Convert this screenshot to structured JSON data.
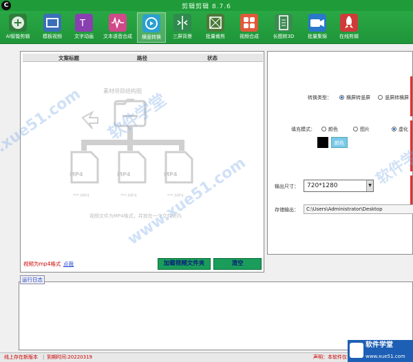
{
  "window": {
    "title": "剪辑剪辑 8.7.6",
    "logo": "C"
  },
  "toolbar": [
    {
      "id": "ai-clip",
      "label": "AI智能剪辑",
      "color": "#2f7d3b",
      "active": false
    },
    {
      "id": "template-video",
      "label": "模板视频",
      "color": "#3a6fb8",
      "active": false
    },
    {
      "id": "text-animation",
      "label": "文字动画",
      "color": "#8a3fb0",
      "active": false
    },
    {
      "id": "text-to-speech",
      "label": "文本语音合成",
      "color": "#d04a8a",
      "active": false
    },
    {
      "id": "landscape-convert",
      "label": "横竖转换",
      "color": "#2aa0d0",
      "active": true
    },
    {
      "id": "three-screen",
      "label": "三屏背景",
      "color": "#2f8a4e",
      "active": false
    },
    {
      "id": "batch-cut",
      "label": "批量裁剪",
      "color": "#4a7a38",
      "active": false
    },
    {
      "id": "video-merge",
      "label": "视频合成",
      "color": "#e05a3a",
      "active": false
    },
    {
      "id": "long-to-3d",
      "label": "长图转3D",
      "color": "#3d8a52",
      "active": false
    },
    {
      "id": "batch-merge",
      "label": "批量集锦",
      "color": "#2a78c8",
      "active": false
    },
    {
      "id": "online-clip",
      "label": "在线剪辑",
      "color": "#d03a3a",
      "active": false
    }
  ],
  "file_table": {
    "columns": [
      "文案标题",
      "路径",
      "状态"
    ]
  },
  "diagram": {
    "title": "素材项目结构图",
    "files": [
      "MP4",
      "MP4",
      "MP4"
    ],
    "file_names": [
      "***.MP4",
      "***.MP4",
      "***.MP4"
    ],
    "note": "视频文件为MP4格式，并放在一个文件夹内"
  },
  "left_footer": {
    "hint": "视频为mp4格式",
    "link": "点我",
    "load_button": "加载视频文件夹",
    "clear_button": "清空"
  },
  "settings": {
    "convert_type_label": "转换类型：",
    "convert_options": [
      {
        "label": "横屏转竖屏",
        "checked": true
      },
      {
        "label": "竖屏转横屏",
        "checked": false
      }
    ],
    "fill_mode_label": "填充模式：",
    "fill_options": [
      {
        "label": "颜色",
        "checked": false
      },
      {
        "label": "图片",
        "checked": false
      },
      {
        "label": "虚化",
        "checked": true
      }
    ],
    "color_button": "颜色",
    "output_size_label": "输出尺寸：",
    "output_size": "720*1280",
    "save_output_label": "存储输出：",
    "save_path": "C:\\Users\\Administrator\\Desktop"
  },
  "log": {
    "label": "运行日志"
  },
  "statusbar": {
    "version": "线上存在新版本",
    "expiry": "到期时间:20220319",
    "notice": "声明：本软件仅"
  },
  "watermarks": [
    "软件学堂",
    "www.xue51.com",
    "软件学堂",
    "www.xue51.com"
  ],
  "corner_logo": {
    "title": "软件学堂",
    "url": "www.xue51.com"
  }
}
